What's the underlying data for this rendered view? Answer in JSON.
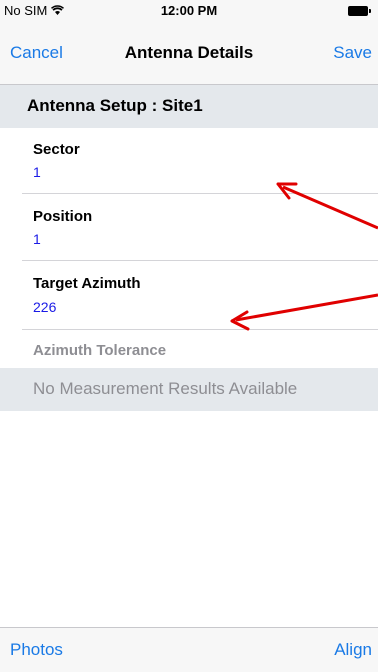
{
  "status_bar": {
    "carrier": "No SIM",
    "time": "12:00 PM",
    "wifi_icon": "wifi-icon",
    "battery_icon": "battery-icon"
  },
  "nav": {
    "cancel": "Cancel",
    "title": "Antenna Details",
    "save": "Save"
  },
  "section": {
    "title": "Antenna Setup : Site1"
  },
  "fields": [
    {
      "label": "Sector",
      "value": "1"
    },
    {
      "label": "Position",
      "value": "1"
    },
    {
      "label": "Target Azimuth",
      "value": "226"
    }
  ],
  "tolerance": {
    "label": "Azimuth Tolerance"
  },
  "results": {
    "message": "No Measurement Results Available"
  },
  "toolbar": {
    "photos": "Photos",
    "align": "Align"
  },
  "colors": {
    "accent": "#1a7ae6",
    "value_text": "#1a1ae6",
    "annotation": "#e00000",
    "section_bg": "#e4e8ec"
  }
}
